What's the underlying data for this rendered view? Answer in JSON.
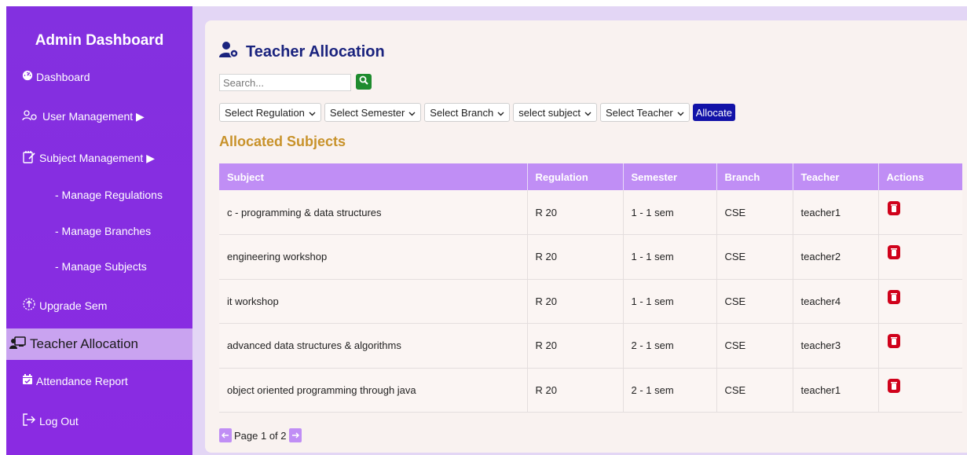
{
  "sidebar": {
    "title": "Admin Dashboard",
    "dashboard": "Dashboard",
    "user_management": "User Management ▶",
    "subject_management": "Subject Management ▶",
    "manage_regulations": "- Manage Regulations",
    "manage_branches": "- Manage Branches",
    "manage_subjects": "- Manage Subjects",
    "upgrade_sem": "Upgrade Sem",
    "teacher_allocation": "Teacher Allocation",
    "attendance_report": "Attendance Report",
    "log_out": "Log Out"
  },
  "main": {
    "title": "Teacher Allocation",
    "search_placeholder": "Search...",
    "filters": {
      "regulation": "Select Regulation",
      "semester": "Select Semester",
      "branch": "Select Branch",
      "subject": "select subject",
      "teacher": "Select Teacher",
      "allocate": "Allocate"
    },
    "section_title": "Allocated Subjects",
    "table": {
      "headers": [
        "Subject",
        "Regulation",
        "Semester",
        "Branch",
        "Teacher",
        "Actions"
      ],
      "rows": [
        [
          "c - programming & data structures",
          "R 20",
          "1 - 1 sem",
          "CSE",
          "teacher1"
        ],
        [
          "engineering workshop",
          "R 20",
          "1 - 1 sem",
          "CSE",
          "teacher2"
        ],
        [
          "it workshop",
          "R 20",
          "1 - 1 sem",
          "CSE",
          "teacher4"
        ],
        [
          "advanced data structures & algorithms",
          "R 20",
          "2 - 1 sem",
          "CSE",
          "teacher3"
        ],
        [
          "object oriented programming through java",
          "R 20",
          "2 - 1 sem",
          "CSE",
          "teacher1"
        ]
      ]
    },
    "pagination": "Page 1 of 2"
  },
  "colors": {
    "sidebar": "#8a2be2",
    "sidebar_active": "#c9a3f0",
    "table_header": "#c08ef5",
    "title": "#1a237e",
    "section_title": "#c8922a",
    "allocate_button": "#1212a8",
    "search_button": "#1e8b2e",
    "delete_icon": "#d0021b"
  }
}
